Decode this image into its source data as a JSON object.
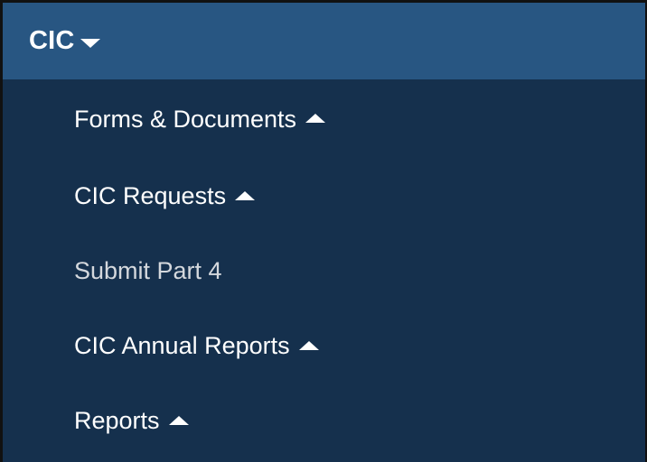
{
  "menu": {
    "title": "CIC",
    "title_icon": "caret-down-icon",
    "items": [
      {
        "label": "Forms & Documents",
        "icon": "caret-up-icon"
      },
      {
        "label": "CIC Requests",
        "icon": "caret-up-icon"
      },
      {
        "label": "Submit Part 4",
        "icon": null
      },
      {
        "label": "CIC Annual Reports",
        "icon": "caret-up-icon"
      },
      {
        "label": "Reports",
        "icon": "caret-up-icon"
      }
    ]
  },
  "colors": {
    "header_bg": "#285682",
    "menu_bg": "#15304d",
    "text_primary": "#ffffff",
    "text_muted": "#d4d8dd"
  }
}
